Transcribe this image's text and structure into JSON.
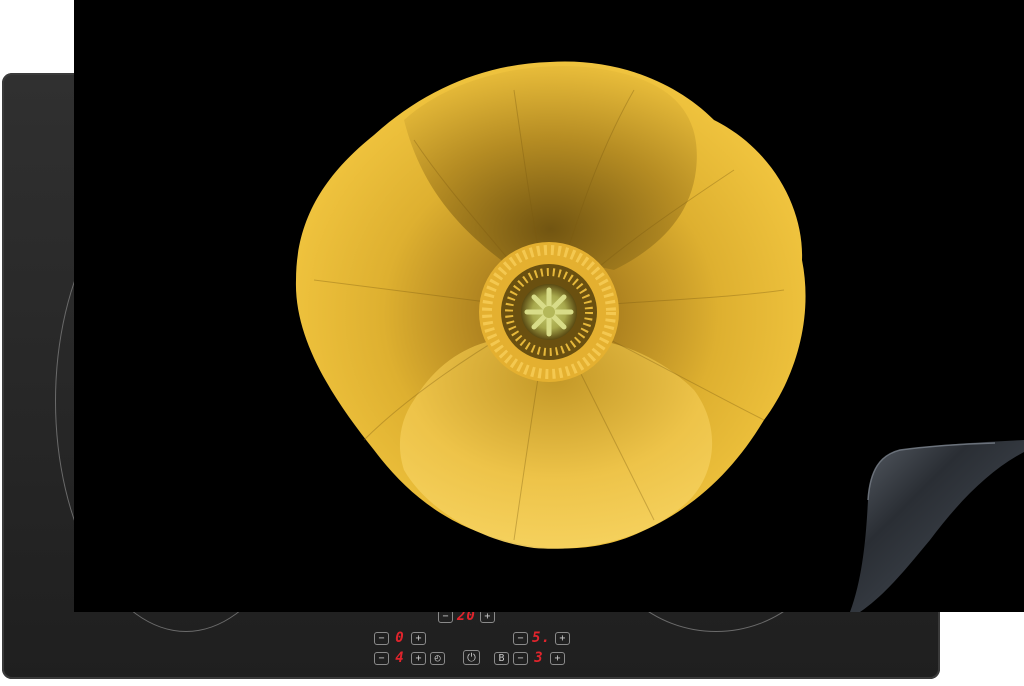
{
  "product": {
    "type": "induction-hob-protector",
    "print": "yellow-poppy-flower-on-black",
    "colors": {
      "cover": "#000000",
      "petal": "#e0b02a",
      "petal_dark": "#8a6510",
      "center": "#b8c060",
      "display_digit": "#e0242c"
    }
  },
  "control_panel": {
    "top_center_display": "20",
    "front_left_display": "0",
    "front_left_level": "4",
    "front_right_display": "5.",
    "front_right_level": "3",
    "minus_symbol": "−",
    "plus_symbol": "+",
    "timer_symbol": "◴",
    "power_symbol": "⏻",
    "boost_symbol": "B"
  }
}
